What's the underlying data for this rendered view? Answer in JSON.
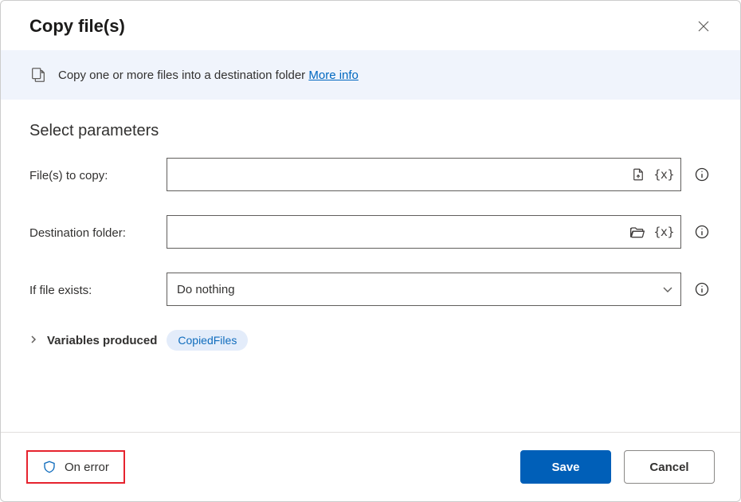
{
  "header": {
    "title": "Copy file(s)"
  },
  "banner": {
    "text": "Copy one or more files into a destination folder",
    "link_label": "More info"
  },
  "section": {
    "title": "Select parameters"
  },
  "params": {
    "files_to_copy": {
      "label": "File(s) to copy:",
      "value": ""
    },
    "destination": {
      "label": "Destination folder:",
      "value": ""
    },
    "if_exists": {
      "label": "If file exists:",
      "value": "Do nothing"
    }
  },
  "variables": {
    "label": "Variables produced",
    "pill": "CopiedFiles"
  },
  "footer": {
    "on_error": "On error",
    "save": "Save",
    "cancel": "Cancel"
  }
}
